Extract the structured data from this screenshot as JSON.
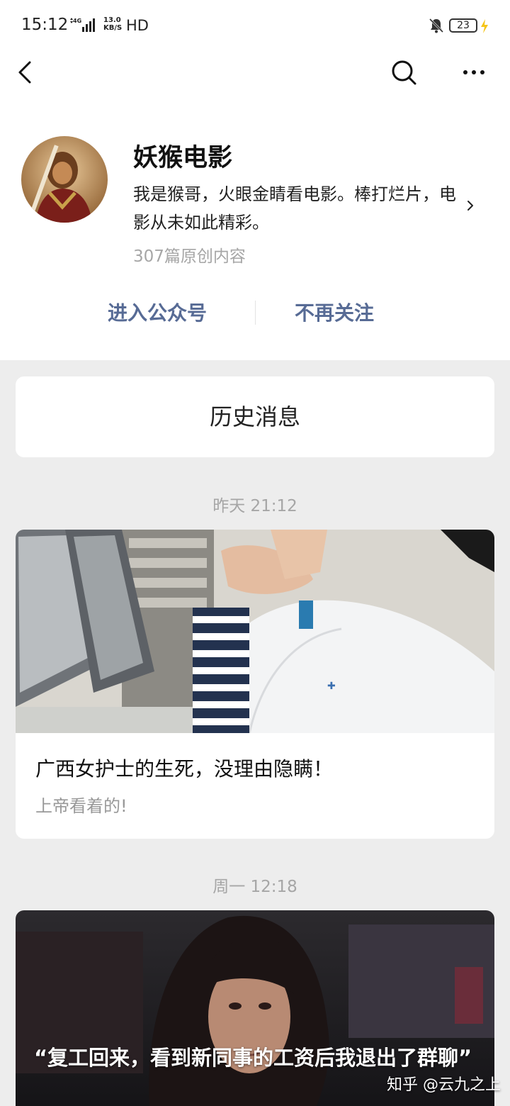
{
  "status_bar": {
    "time": "15:12",
    "network": "4G",
    "speed_value": "13.0",
    "speed_unit": "KB/S",
    "hd": "HD",
    "battery": "23"
  },
  "header": {
    "back_icon": "back-icon",
    "search_icon": "search-icon",
    "more_icon": "more-icon"
  },
  "profile": {
    "name": "妖猴电影",
    "description": "我是猴哥，火眼金睛看电影。棒打烂片，电影从未如此精彩。",
    "original_count": "307篇原创内容",
    "enter_button": "进入公众号",
    "unfollow_button": "不再关注"
  },
  "history": {
    "label": "历史消息"
  },
  "articles": [
    {
      "timestamp": "昨天 21:12",
      "title": "广西女护士的生死，没理由隐瞒！",
      "digest": "上帝看着的!"
    },
    {
      "timestamp": "周一 12:18",
      "title": "“复工回来，看到新同事的工资后我退出了群聊”"
    }
  ],
  "watermark": "知乎 @云九之上",
  "colors": {
    "link_blue": "#576b95",
    "page_bg": "#ededed",
    "muted_gray": "#a6a6a6"
  }
}
